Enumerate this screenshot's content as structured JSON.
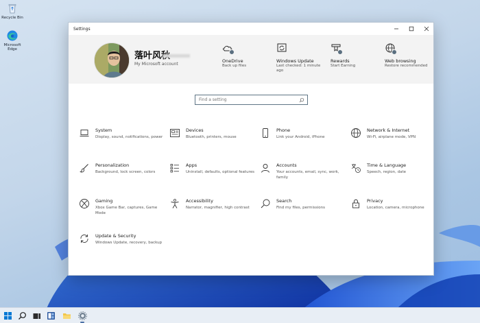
{
  "desktop": {
    "icons": [
      {
        "label": "Recycle Bin",
        "icon": "recycle-bin-icon"
      },
      {
        "label": "Microsoft Edge",
        "icon": "edge-icon"
      }
    ]
  },
  "window": {
    "title": "Settings",
    "controls": [
      "minimize-icon",
      "maximize-icon",
      "close-icon"
    ]
  },
  "account": {
    "name": "落叶风秋",
    "link": "My Microsoft account"
  },
  "quick_links": [
    {
      "title": "OneDrive",
      "subtitle": "Back up files",
      "icon": "onedrive-icon"
    },
    {
      "title": "Windows Update",
      "subtitle": "Last checked: 1 minute ago",
      "icon": "windows-update-icon"
    },
    {
      "title": "Rewards",
      "subtitle": "Start Earning",
      "icon": "rewards-icon"
    },
    {
      "title": "Web browsing",
      "subtitle": "Restore recommended",
      "icon": "globe-icon"
    }
  ],
  "search": {
    "placeholder": "Find a setting"
  },
  "categories": [
    {
      "title": "System",
      "subtitle": "Display, sound, notifications, power",
      "icon": "laptop-icon"
    },
    {
      "title": "Devices",
      "subtitle": "Bluetooth, printers, mouse",
      "icon": "keyboard-icon"
    },
    {
      "title": "Phone",
      "subtitle": "Link your Android, iPhone",
      "icon": "phone-icon"
    },
    {
      "title": "Network & Internet",
      "subtitle": "Wi-Fi, airplane mode, VPN",
      "icon": "globe-icon"
    },
    {
      "title": "Personalization",
      "subtitle": "Background, lock screen, colors",
      "icon": "paintbrush-icon"
    },
    {
      "title": "Apps",
      "subtitle": "Uninstall, defaults, optional features",
      "icon": "apps-list-icon"
    },
    {
      "title": "Accounts",
      "subtitle": "Your accounts, email, sync, work, family",
      "icon": "person-icon"
    },
    {
      "title": "Time & Language",
      "subtitle": "Speech, region, date",
      "icon": "time-language-icon"
    },
    {
      "title": "Gaming",
      "subtitle": "Xbox Game Bar, captures, Game Mode",
      "icon": "xbox-icon"
    },
    {
      "title": "Accessibility",
      "subtitle": "Narrator, magnifier, high contrast",
      "icon": "accessibility-icon"
    },
    {
      "title": "Search",
      "subtitle": "Find my files, permissions",
      "icon": "search-icon"
    },
    {
      "title": "Privacy",
      "subtitle": "Location, camera, microphone",
      "icon": "lock-icon"
    },
    {
      "title": "Update & Security",
      "subtitle": "Windows Update, recovery, backup",
      "icon": "update-icon"
    }
  ],
  "taskbar": {
    "items": [
      "start-icon",
      "search-icon",
      "task-view-icon",
      "widgets-icon",
      "file-explorer-icon",
      "settings-icon"
    ]
  },
  "colors": {
    "accent": "#5a6f80",
    "header_bg": "#f3f3f3",
    "taskbar_bg": "#e8eef5"
  }
}
